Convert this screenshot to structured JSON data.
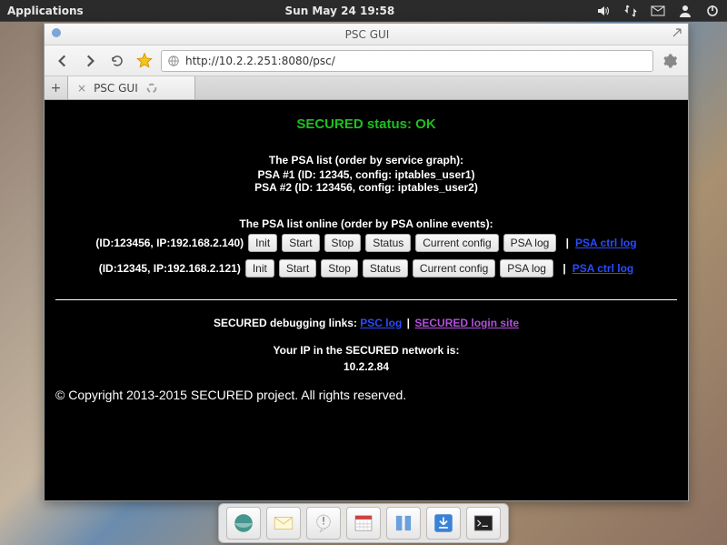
{
  "top_panel": {
    "apps_label": "Applications",
    "datetime": "Sun May 24 19:58"
  },
  "window": {
    "title": "PSC GUI"
  },
  "browser": {
    "url": "http://10.2.2.251:8080/psc/",
    "tab_title": "PSC GUI"
  },
  "page": {
    "status_text": "SECURED status: OK",
    "psa_list_title": "The PSA list (order by service graph):",
    "psa_items": [
      "PSA #1 (ID: 12345, config: iptables_user1)",
      "PSA #2 (ID: 123456, config: iptables_user2)"
    ],
    "online_title": "The PSA list online (order by PSA online events):",
    "online_rows": [
      {
        "meta": "(ID:123456, IP:192.168.2.140)"
      },
      {
        "meta": "(ID:12345, IP:192.168.2.121)"
      }
    ],
    "buttons": {
      "init": "Init",
      "start": "Start",
      "stop": "Stop",
      "status": "Status",
      "current_config": "Current config",
      "psa_log": "PSA log"
    },
    "psa_ctrl_log": "PSA ctrl log",
    "debug_label": "SECURED debugging links: ",
    "psc_log": "PSC log",
    "secured_login_site": "SECURED login site",
    "ip_label": "Your IP in the SECURED network is:",
    "ip_value": "10.2.2.84",
    "copyright": "© Copyright 2013-2015 SECURED project. All rights reserved."
  }
}
